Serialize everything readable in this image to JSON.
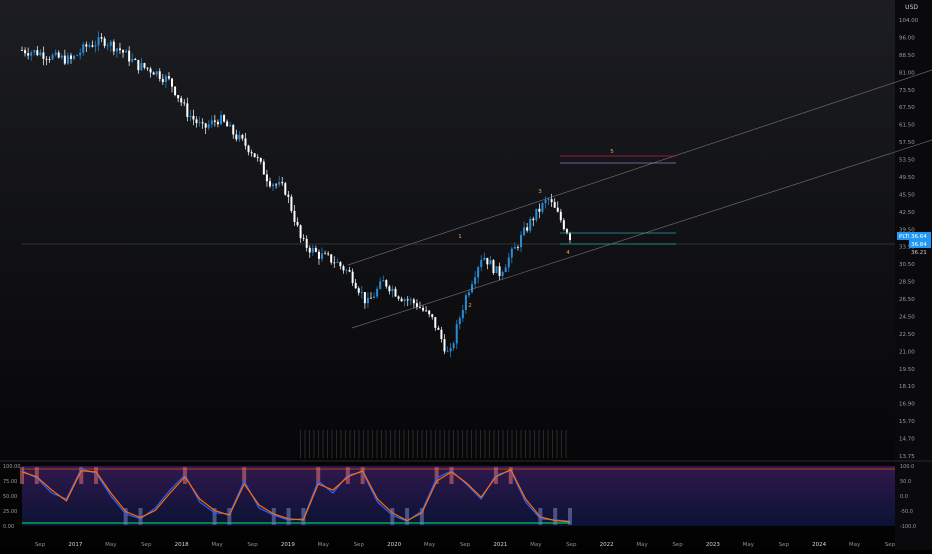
{
  "chart_data": [
    {
      "type": "candlestick",
      "currency_label": "USD",
      "y_scale": "log",
      "ylim": [
        13.2,
        108
      ],
      "y_ticks": [
        "104.00",
        "96.00",
        "88.50",
        "81.00",
        "73.50",
        "67.50",
        "61.50",
        "57.50",
        "53.50",
        "49.50",
        "45.50",
        "42.50",
        "39.50",
        "33.50",
        "30.50",
        "28.50",
        "26.50",
        "24.50",
        "22.50",
        "21.00",
        "19.50",
        "18.10",
        "16.90",
        "15.70",
        "14.70",
        "13.75"
      ],
      "price_label": "PLTR",
      "price_value": "36.64",
      "price_current": "36.84",
      "price_low_label": "36.21",
      "x_labels": [
        "Sep",
        "2017",
        "May",
        "Sep",
        "2018",
        "May",
        "Sep",
        "2019",
        "May",
        "Sep",
        "2020",
        "May",
        "Sep",
        "2021",
        "May",
        "Sep",
        "2022",
        "May",
        "Sep",
        "2023",
        "May",
        "Sep",
        "2024",
        "May",
        "Sep"
      ],
      "wave_labels": [
        "1",
        "2",
        "3",
        "4",
        "5"
      ],
      "series": [
        {
          "t": 0.0,
          "close": 88
        },
        {
          "t": 0.03,
          "close": 87
        },
        {
          "t": 0.06,
          "close": 85
        },
        {
          "t": 0.09,
          "close": 84
        },
        {
          "t": 0.12,
          "close": 90
        },
        {
          "t": 0.15,
          "close": 92
        },
        {
          "t": 0.18,
          "close": 88
        },
        {
          "t": 0.21,
          "close": 82
        },
        {
          "t": 0.24,
          "close": 80
        },
        {
          "t": 0.27,
          "close": 76
        },
        {
          "t": 0.3,
          "close": 66
        },
        {
          "t": 0.33,
          "close": 61
        },
        {
          "t": 0.36,
          "close": 64
        },
        {
          "t": 0.39,
          "close": 59
        },
        {
          "t": 0.42,
          "close": 55
        },
        {
          "t": 0.45,
          "close": 48
        },
        {
          "t": 0.48,
          "close": 46
        },
        {
          "t": 0.51,
          "close": 36
        },
        {
          "t": 0.54,
          "close": 34
        },
        {
          "t": 0.57,
          "close": 33
        },
        {
          "t": 0.6,
          "close": 31
        },
        {
          "t": 0.63,
          "close": 27
        },
        {
          "t": 0.66,
          "close": 30
        },
        {
          "t": 0.69,
          "close": 28
        },
        {
          "t": 0.72,
          "close": 27
        },
        {
          "t": 0.75,
          "close": 25
        },
        {
          "t": 0.78,
          "close": 21
        },
        {
          "t": 0.81,
          "close": 28
        },
        {
          "t": 0.84,
          "close": 34
        },
        {
          "t": 0.87,
          "close": 31
        },
        {
          "t": 0.9,
          "close": 35
        },
        {
          "t": 0.93,
          "close": 40
        },
        {
          "t": 0.96,
          "close": 44
        },
        {
          "t": 1.0,
          "close": 37
        }
      ]
    },
    {
      "type": "oscillator",
      "left_ticks": [
        "100.00",
        "75.00",
        "50.00",
        "25.00",
        "0.00"
      ],
      "right_ticks": [
        "100.0",
        "50.0",
        "0.0",
        "-50.0",
        "-100.0"
      ],
      "ylim": [
        0,
        100
      ],
      "series": [
        {
          "name": "",
          "color": "#2962ff",
          "values": [
            92,
            80,
            55,
            45,
            95,
            88,
            50,
            20,
            12,
            30,
            60,
            85,
            40,
            22,
            20,
            75,
            30,
            18,
            10,
            12,
            75,
            55,
            85,
            90,
            40,
            18,
            8,
            25,
            80,
            92,
            70,
            45,
            85,
            92,
            40,
            12,
            10,
            8
          ]
        },
        {
          "name": "",
          "color": "#ff6d00",
          "values": [
            90,
            82,
            60,
            42,
            92,
            90,
            55,
            24,
            14,
            26,
            55,
            82,
            45,
            26,
            18,
            70,
            35,
            20,
            12,
            10,
            70,
            60,
            82,
            92,
            45,
            22,
            9,
            22,
            75,
            90,
            72,
            48,
            82,
            94,
            45,
            15,
            9,
            7
          ]
        }
      ]
    }
  ],
  "colors": {
    "up": "#2a8cd6",
    "down": "#ffffff",
    "channel": "#8c8c8c",
    "target_upper": "#c2185b",
    "target_lower": "#9575cd",
    "support": "#26a69a",
    "wave_label": "#f5a25d",
    "price_badge": "#2196f3",
    "osc_top": "#e65100",
    "osc_bottom": "#00c853"
  }
}
